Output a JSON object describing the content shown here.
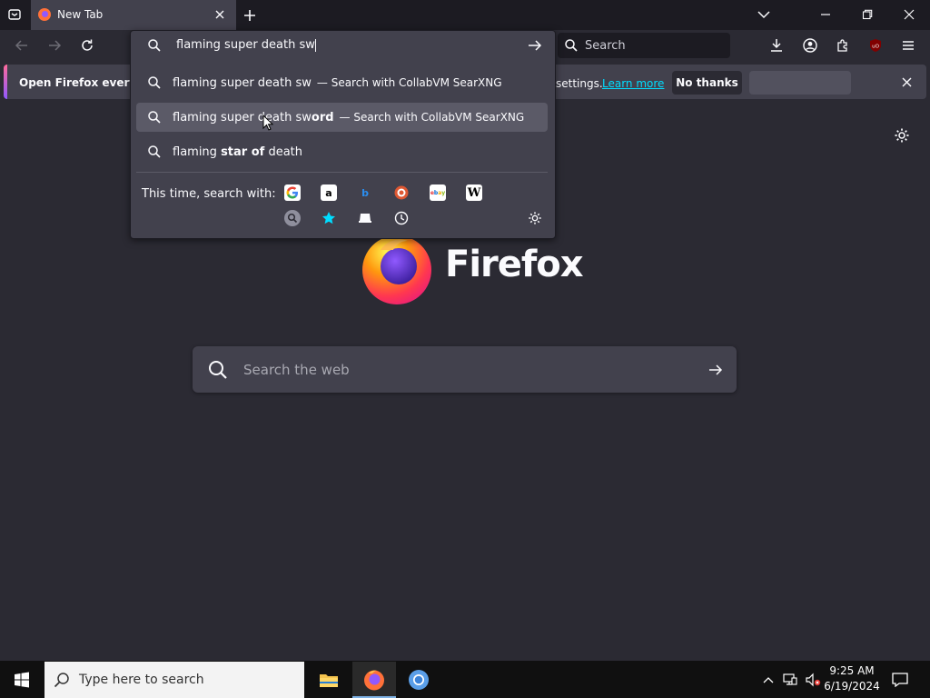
{
  "tab": {
    "title": "New Tab"
  },
  "urlbar": {
    "value": "flaming super death sw"
  },
  "suggestions": [
    {
      "prefix": "flaming super death sw",
      "bold": "",
      "suffix": "— Search with CollabVM SearXNG"
    },
    {
      "prefix": "flaming super death sw",
      "bold": "ord",
      "suffix": "— Search with CollabVM SearXNG"
    },
    {
      "prefix": "flaming ",
      "bold": "star of",
      "rest": " death"
    }
  ],
  "one_off": {
    "label": "This time, search with:"
  },
  "notification": {
    "text": "Open Firefox every ti",
    "text_right": "settings.",
    "link": "Learn more",
    "no_thanks": "No thanks"
  },
  "search": {
    "placeholder": "Search"
  },
  "brand": {
    "name": "Firefox"
  },
  "websearch": {
    "placeholder": "Search the web"
  },
  "taskbar": {
    "search_placeholder": "Type here to search",
    "time": "9:25 AM",
    "date": "6/19/2024"
  },
  "colors": {
    "accent": "#a0c4ff",
    "link": "#00ddff",
    "bg": "#2b2a33",
    "panel": "#42414d"
  }
}
